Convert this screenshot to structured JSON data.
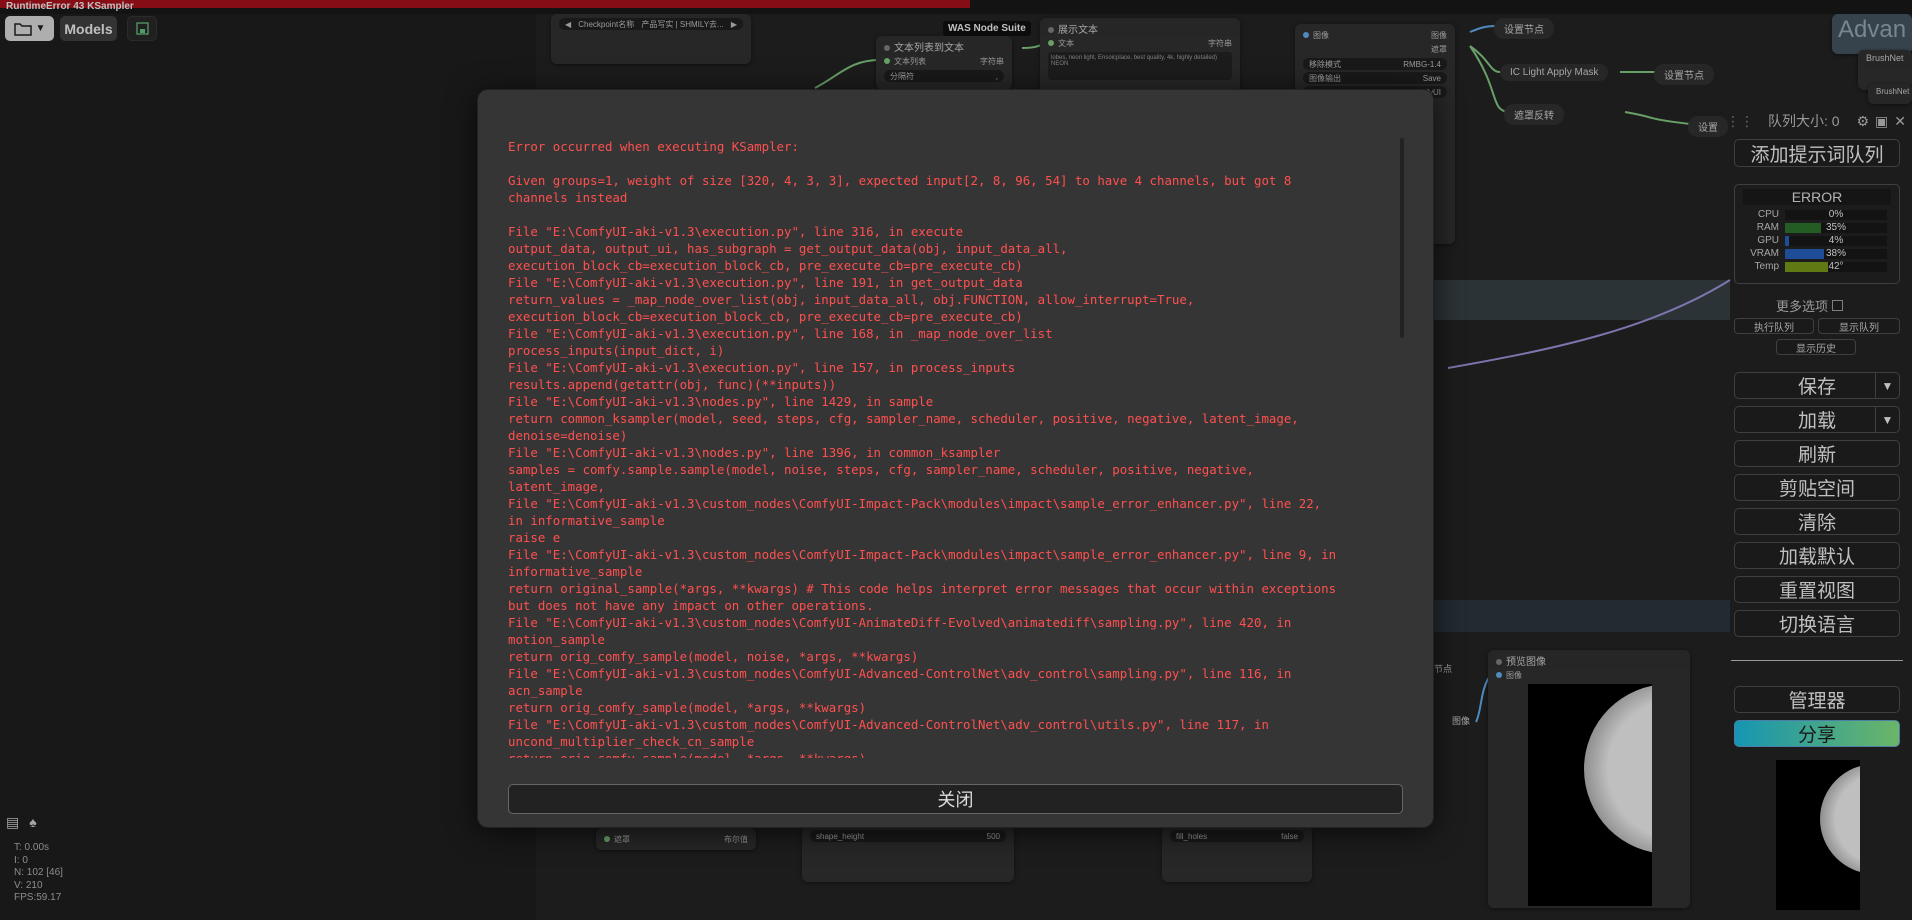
{
  "window": {
    "title": "RuntimeError 43 KSampler"
  },
  "toolbar": {
    "folder_icon": "folder-icon",
    "models_label": "Models",
    "save_icon": "save-icon"
  },
  "canvas": {
    "nodes": {
      "checkpoint": {
        "label": "Checkpoint名称",
        "value": "产品写实 | SHMILY去..."
      },
      "text_list": {
        "title": "文本列表到文本",
        "in_label": "文本列表",
        "out_label": "字符串",
        "widget_label": "分隔符",
        "widget_value": ","
      },
      "show_text": {
        "title": "展示文本",
        "in_label": "文本",
        "out_label": "字符串",
        "body": "lobes, neon light, Ensoicplace, best quality, 4k, highly detailed) NEON"
      },
      "image_node": {
        "in_label": "图像",
        "out_image": "图像",
        "out_mask": "遮罩",
        "w1_label": "移除模式",
        "w1_value": "RMBG-1.4",
        "w2_label": "图像输出",
        "w2_value": "Save",
        "w3_value": "ComfyUI"
      },
      "set_node_1": "设置节点",
      "set_node_2": "设置节点",
      "set_node_3": "设置",
      "ic_light": "IC Light Apply Mask",
      "mask_invert": "遮罩反转",
      "preview": {
        "title": "预览图像",
        "in_label": "图像",
        "side_label": "图像",
        "side_frag": "节点"
      },
      "brushnet_1": "BrushNet",
      "brushnet_2": "BrushNet",
      "bottom_mask": {
        "left": "遮罩",
        "right": "布尔值"
      },
      "shape_height": {
        "label": "shape_height",
        "value": "500"
      },
      "fill_holes": {
        "label": "fill_holes",
        "value": "false"
      },
      "top_right_frag": "Advan"
    },
    "was_badge": "WAS Node Suite"
  },
  "stats": {
    "icons": [
      "document-icon",
      "tree-icon"
    ],
    "lines": [
      "T: 0.00s",
      "I: 0",
      "N: 102 [46]",
      "V: 210",
      "FPS:59.17"
    ]
  },
  "panel": {
    "queue_label": "队列大小: 0",
    "add_prompt": "添加提示词队列",
    "status": "ERROR",
    "meters": [
      {
        "label": "CPU",
        "value": 0,
        "text": "0%",
        "color": "#2a8a2a"
      },
      {
        "label": "RAM",
        "value": 35,
        "text": "35%",
        "color": "#2f7d2f"
      },
      {
        "label": "GPU",
        "value": 4,
        "text": "4%",
        "color": "#2a66c9"
      },
      {
        "label": "VRAM",
        "value": 38,
        "text": "38%",
        "color": "#2a66c9"
      },
      {
        "label": "Temp",
        "value": 42,
        "text": "42°",
        "color": "#7fa31a"
      }
    ],
    "more_options": "更多选项",
    "exec_queue": "执行队列",
    "show_queue": "显示队列",
    "show_history": "显示历史",
    "buttons": {
      "save": "保存",
      "load": "加载",
      "refresh": "刷新",
      "clipspace": "剪贴空间",
      "clear": "清除",
      "load_default": "加载默认",
      "reset_view": "重置视图",
      "switch_lang": "切换语言",
      "manager": "管理器",
      "share": "分享"
    }
  },
  "dialog": {
    "message": "Error occurred when executing KSampler:\n\nGiven groups=1, weight of size [320, 4, 3, 3], expected input[2, 8, 96, 54] to have 4 channels, but got 8\nchannels instead\n\nFile \"E:\\ComfyUI-aki-v1.3\\execution.py\", line 316, in execute\noutput_data, output_ui, has_subgraph = get_output_data(obj, input_data_all,\nexecution_block_cb=execution_block_cb, pre_execute_cb=pre_execute_cb)\nFile \"E:\\ComfyUI-aki-v1.3\\execution.py\", line 191, in get_output_data\nreturn_values = _map_node_over_list(obj, input_data_all, obj.FUNCTION, allow_interrupt=True,\nexecution_block_cb=execution_block_cb, pre_execute_cb=pre_execute_cb)\nFile \"E:\\ComfyUI-aki-v1.3\\execution.py\", line 168, in _map_node_over_list\nprocess_inputs(input_dict, i)\nFile \"E:\\ComfyUI-aki-v1.3\\execution.py\", line 157, in process_inputs\nresults.append(getattr(obj, func)(**inputs))\nFile \"E:\\ComfyUI-aki-v1.3\\nodes.py\", line 1429, in sample\nreturn common_ksampler(model, seed, steps, cfg, sampler_name, scheduler, positive, negative, latent_image,\ndenoise=denoise)\nFile \"E:\\ComfyUI-aki-v1.3\\nodes.py\", line 1396, in common_ksampler\nsamples = comfy.sample.sample(model, noise, steps, cfg, sampler_name, scheduler, positive, negative,\nlatent_image,\nFile \"E:\\ComfyUI-aki-v1.3\\custom_nodes\\ComfyUI-Impact-Pack\\modules\\impact\\sample_error_enhancer.py\", line 22,\nin informative_sample\nraise e\nFile \"E:\\ComfyUI-aki-v1.3\\custom_nodes\\ComfyUI-Impact-Pack\\modules\\impact\\sample_error_enhancer.py\", line 9, in\ninformative_sample\nreturn original_sample(*args, **kwargs) # This code helps interpret error messages that occur within exceptions\nbut does not have any impact on other operations.\nFile \"E:\\ComfyUI-aki-v1.3\\custom_nodes\\ComfyUI-AnimateDiff-Evolved\\animatediff\\sampling.py\", line 420, in\nmotion_sample\nreturn orig_comfy_sample(model, noise, *args, **kwargs)\nFile \"E:\\ComfyUI-aki-v1.3\\custom_nodes\\ComfyUI-Advanced-ControlNet\\adv_control\\sampling.py\", line 116, in\nacn_sample\nreturn orig_comfy_sample(model, *args, **kwargs)\nFile \"E:\\ComfyUI-aki-v1.3\\custom_nodes\\ComfyUI-Advanced-ControlNet\\adv_control\\utils.py\", line 117, in\nuncond_multiplier_check_cn_sample\nreturn orig_comfy_sample(model, *args, **kwargs)",
    "close_label": "关闭"
  }
}
